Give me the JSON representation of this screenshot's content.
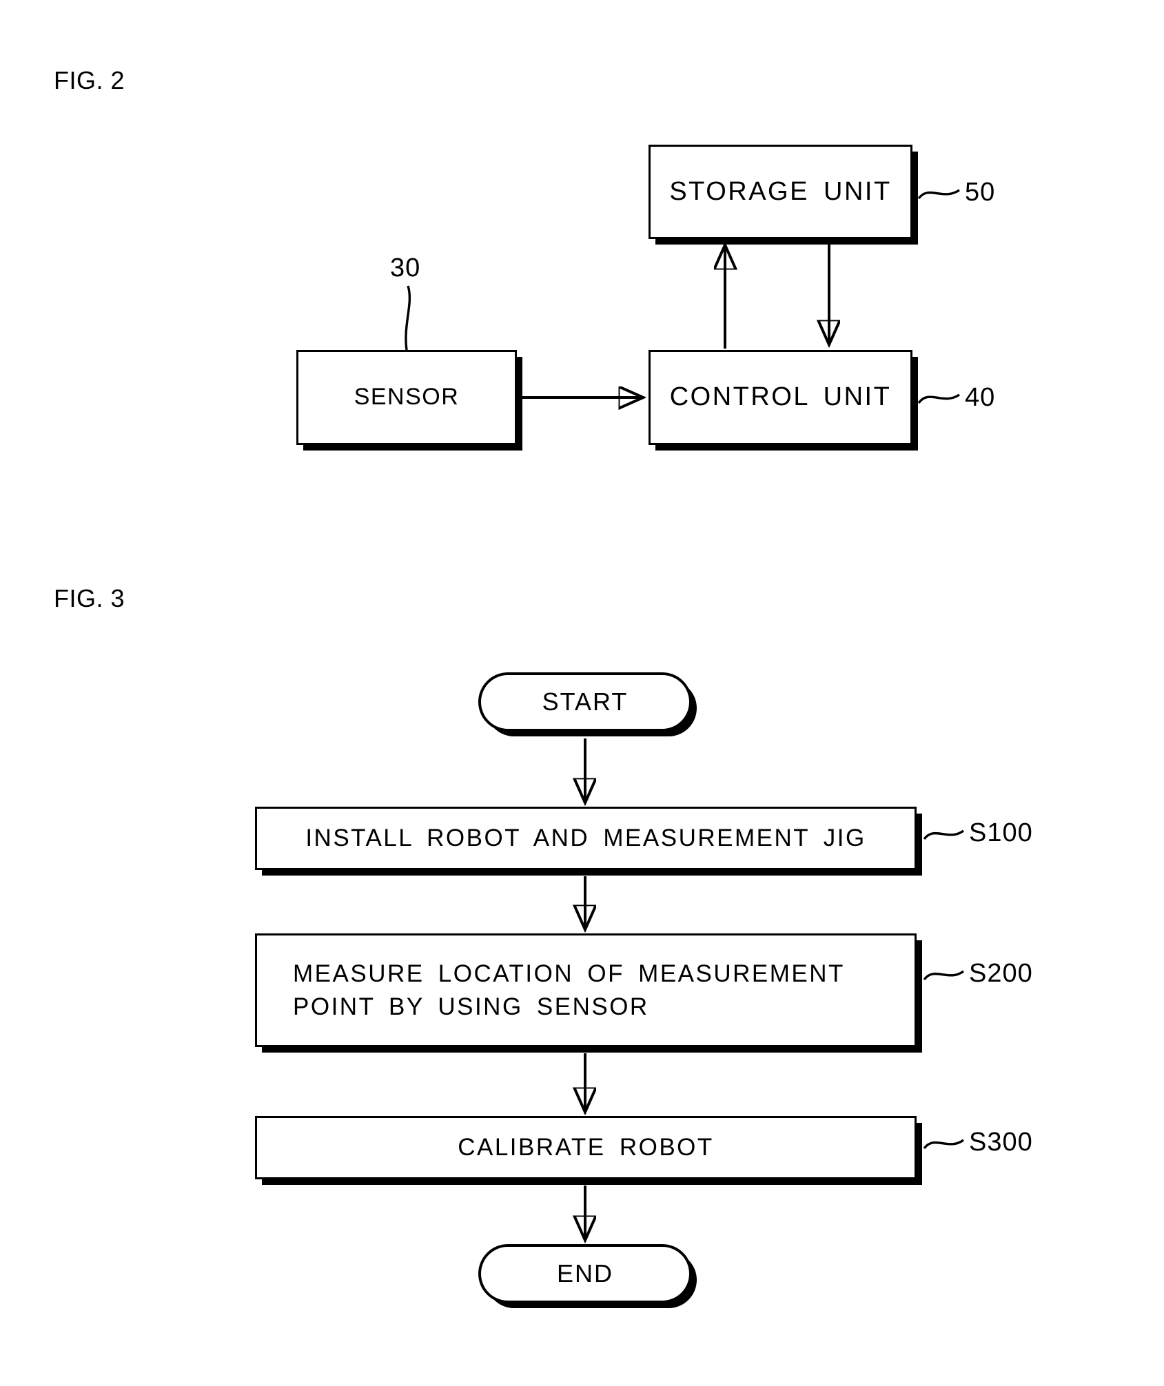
{
  "figures": [
    {
      "id": "fig2",
      "label": "FIG. 2",
      "type": "block-diagram",
      "blocks": [
        {
          "id": "storage-unit",
          "text": "STORAGE UNIT",
          "ref": "50"
        },
        {
          "id": "sensor",
          "text": "SENSOR",
          "ref": "30"
        },
        {
          "id": "control-unit",
          "text": "CONTROL UNIT",
          "ref": "40"
        }
      ],
      "connections": [
        {
          "from": "sensor",
          "to": "control-unit",
          "direction": "right",
          "arrow": true
        },
        {
          "from": "control-unit",
          "to": "storage-unit",
          "direction": "up",
          "arrow": true
        },
        {
          "from": "storage-unit",
          "to": "control-unit",
          "direction": "down",
          "arrow": true
        }
      ]
    },
    {
      "id": "fig3",
      "label": "FIG. 3",
      "type": "flowchart",
      "nodes": [
        {
          "id": "start",
          "kind": "terminal",
          "text": "START"
        },
        {
          "id": "s100",
          "kind": "process",
          "text": "INSTALL ROBOT AND MEASUREMENT JIG",
          "ref": "S100"
        },
        {
          "id": "s200",
          "kind": "process",
          "text": "MEASURE LOCATION OF MEASUREMENT\nPOINT BY USING SENSOR",
          "ref": "S200"
        },
        {
          "id": "s300",
          "kind": "process",
          "text": "CALIBRATE ROBOT",
          "ref": "S300"
        },
        {
          "id": "end",
          "kind": "terminal",
          "text": "END"
        }
      ],
      "flow": [
        "start",
        "s100",
        "s200",
        "s300",
        "end"
      ]
    }
  ],
  "fig2": {
    "label": "FIG. 2",
    "storage_unit": "STORAGE UNIT",
    "storage_ref": "50",
    "sensor": "SENSOR",
    "sensor_ref": "30",
    "control_unit": "CONTROL UNIT",
    "control_ref": "40"
  },
  "fig3": {
    "label": "FIG. 3",
    "start": "START",
    "end": "END",
    "step1": "INSTALL ROBOT AND MEASUREMENT JIG",
    "step1_ref": "S100",
    "step2": "MEASURE LOCATION OF MEASUREMENT\nPOINT BY USING SENSOR",
    "step2_ref": "S200",
    "step3": "CALIBRATE ROBOT",
    "step3_ref": "S300"
  },
  "colors": {
    "ink": "#000000",
    "paper": "#ffffff"
  }
}
